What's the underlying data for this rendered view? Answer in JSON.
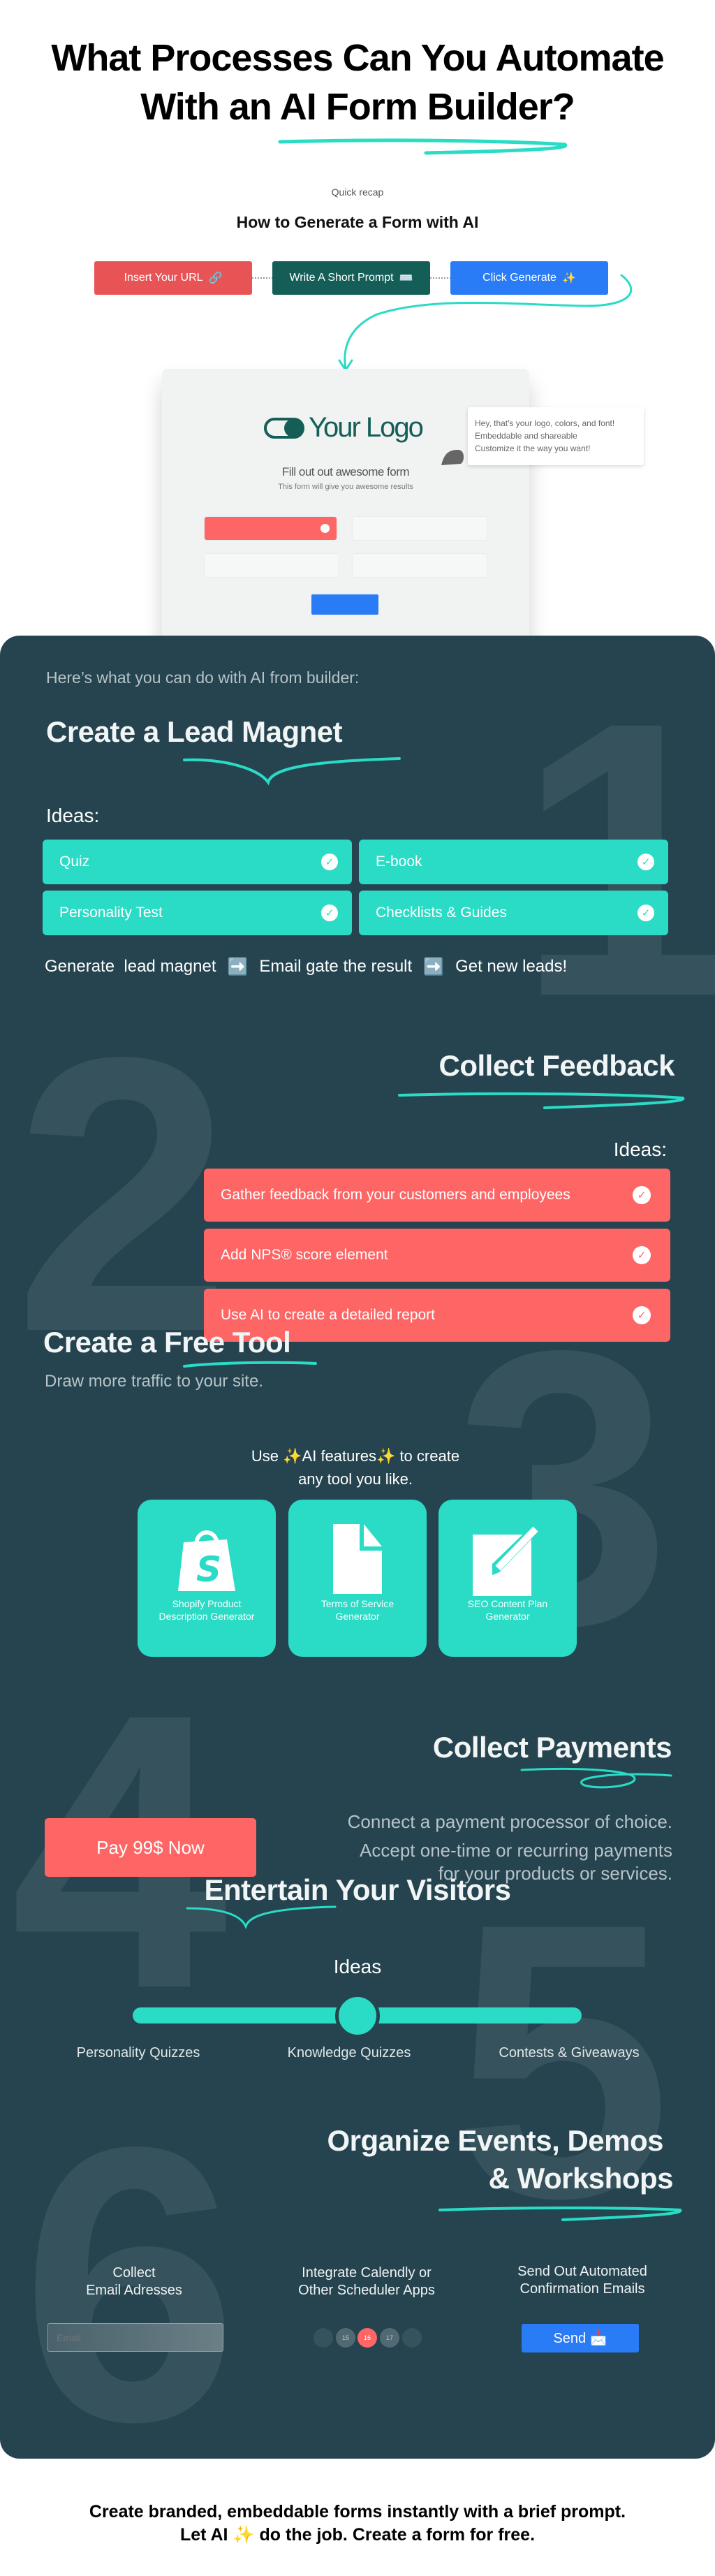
{
  "header": {
    "title_line1": "What Processes Can You Automate",
    "title_line2": "With an AI Form Builder?"
  },
  "recap": {
    "label": "Quick recap",
    "title": "How to Generate a Form with AI",
    "steps": [
      {
        "label": "Insert Your URL",
        "icon": "🔗",
        "color": "#e85456"
      },
      {
        "label": "Write A Short Prompt",
        "icon": "⌨️",
        "color": "#155e57"
      },
      {
        "label": "Click Generate",
        "icon": "✨",
        "color": "#2a7bf6"
      }
    ]
  },
  "form_preview": {
    "logo_text": "Your Logo",
    "title": "Fill out out awesome form",
    "subtitle": "This form will give you awesome results",
    "tooltip": [
      "Hey, that's your logo, colors, and font!",
      "Embeddable and shareable",
      "Customize it the way you want!"
    ]
  },
  "intro": "Here’s what you can do with AI from builder:",
  "big_numbers": [
    "1",
    "2",
    "3",
    "4",
    "5",
    "6"
  ],
  "lead_magnet": {
    "title_a": "Create a ",
    "title_b": "Lead Magnet",
    "ideas_label": "Ideas:",
    "ideas": [
      "Quiz",
      "E-book",
      "Personality Test",
      "Checklists & Guides"
    ],
    "flow": [
      "Generate  lead magnet",
      "Email gate the result",
      "Get new leads!"
    ],
    "arrow_icon": "➡️"
  },
  "feedback": {
    "title": "Collect Feedback",
    "ideas_label": "Ideas:",
    "items": [
      "Gather feedback from your customers and employees",
      "Add NPS® score element",
      "Use AI to create a detailed report"
    ]
  },
  "free_tool": {
    "title_a": "Create a ",
    "title_b": "Free Tool",
    "subtitle": "Draw more traffic to your site.",
    "intro_line1": "Use ✨AI features✨ to create",
    "intro_line2": "any tool you like.",
    "tiles": [
      {
        "label": "Shopify Product Description Generator",
        "icon": "shopify-bag-icon"
      },
      {
        "label": "Terms of Service Generator",
        "icon": "document-icon"
      },
      {
        "label": "SEO Content Plan Generator",
        "icon": "edit-icon"
      }
    ]
  },
  "payments": {
    "title_a": "Collect ",
    "title_b": "Payments",
    "button": "Pay 99$ Now",
    "text": [
      "Connect a payment processor of choice.",
      "Accept one-time or recurring payments",
      "for your products or services."
    ]
  },
  "entertain": {
    "title_a": "Entertain",
    "title_b": " Your Visitors",
    "ideas_label": "Ideas",
    "slider_value": 0.5,
    "options": [
      "Personality Quizzes",
      "Knowledge Quizzes",
      "Contests & Giveaways"
    ]
  },
  "events": {
    "title_line1": "Organize Events, Demos",
    "title_line2": "& Workshops",
    "col1": [
      "Collect",
      "Email Adresses"
    ],
    "col2": [
      "Integrate Calendly or",
      "Other Scheduler Apps"
    ],
    "col3": [
      "Send Out Automated",
      "Confirmation Emails"
    ],
    "email_placeholder": "Email",
    "days": [
      "15",
      "16",
      "17"
    ],
    "send_label": "Send 📩"
  },
  "footer": {
    "line1": "Create branded, embeddable forms instantly with a brief prompt.",
    "line2": "Let AI ✨ do the job. Create a form for free."
  },
  "colors": {
    "teal": "#2adbc6",
    "red": "#fe6565",
    "panel": "#25444f",
    "blue": "#2a7bf6"
  }
}
